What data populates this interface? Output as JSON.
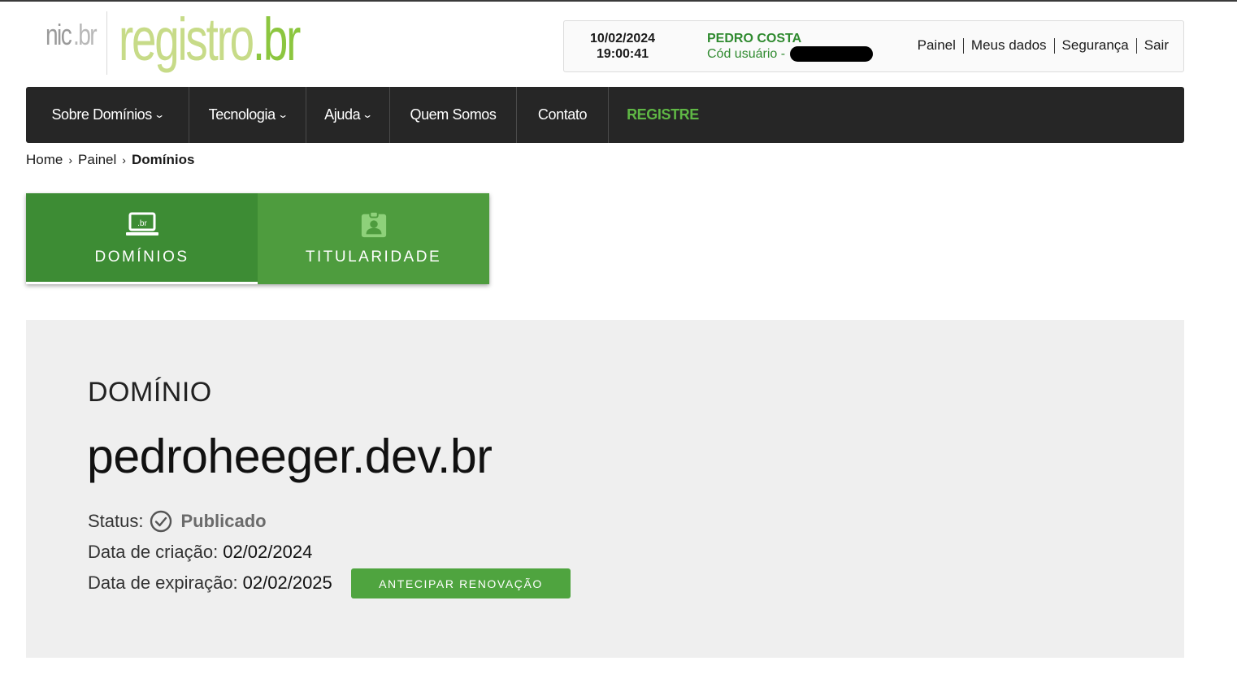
{
  "header": {
    "logo_nic_text": "nic",
    "logo_nic_br": ".br",
    "logo_registro_text": "registro",
    "logo_registro_br": ".br"
  },
  "userpanel": {
    "date": "10/02/2024",
    "time": "19:00:41",
    "user_name": "PEDRO COSTA",
    "user_code_label": "Cód usuário -",
    "links": [
      "Painel",
      "Meus dados",
      "Segurança",
      "Sair"
    ]
  },
  "nav": {
    "items": [
      {
        "label": "Sobre Domínios",
        "dropdown": true
      },
      {
        "label": "Tecnologia",
        "dropdown": true
      },
      {
        "label": "Ajuda",
        "dropdown": true
      },
      {
        "label": "Quem Somos",
        "dropdown": false
      },
      {
        "label": "Contato",
        "dropdown": false
      },
      {
        "label": "REGISTRE",
        "dropdown": false
      }
    ]
  },
  "breadcrumb": {
    "items": [
      "Home",
      "Painel",
      "Domínios"
    ]
  },
  "tabs": [
    {
      "label": "DOMÍNIOS",
      "icon": "laptop-icon",
      "active": true
    },
    {
      "label": "TITULARIDADE",
      "icon": "badge-icon",
      "active": false
    }
  ],
  "domain": {
    "section_title": "DOMÍNIO",
    "name": "pedroheeger.dev.br",
    "status_label": "Status:",
    "status_value": "Publicado",
    "created_label": "Data de criação:",
    "created_value": "02/02/2024",
    "expires_label": "Data de expiração:",
    "expires_value": "02/02/2025",
    "renew_button": "ANTECIPAR RENOVAÇÃO"
  },
  "colors": {
    "brand_green": "#4fa43f",
    "tab_active": "#3d8c34",
    "nav_bg": "#262626",
    "registre_green": "#5fb745"
  }
}
